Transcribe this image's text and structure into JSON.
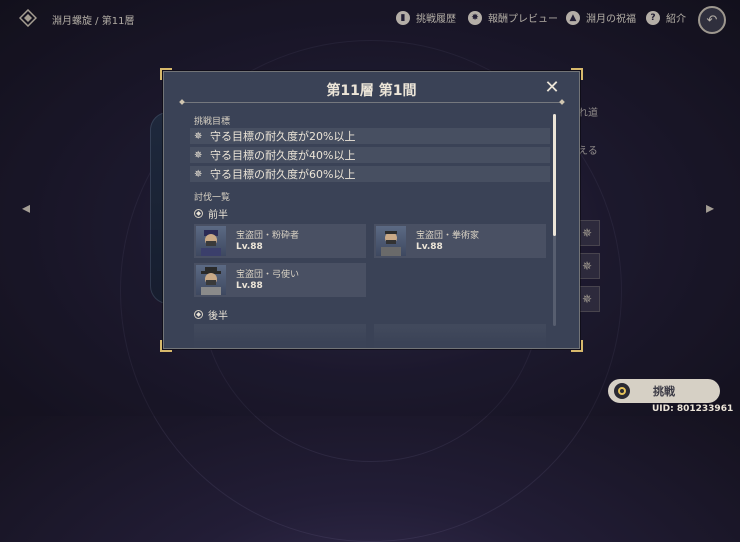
{
  "topbar": {
    "breadcrumb": "淵月螺旋 / 第11層",
    "nav": [
      {
        "label": "挑戦履歴",
        "icon": "book-icon"
      },
      {
        "label": "報酬プレビュー",
        "icon": "gear-icon"
      },
      {
        "label": "淵月の祝福",
        "icon": "blessing-icon"
      },
      {
        "label": "紹介",
        "icon": "help-icon"
      }
    ]
  },
  "background": {
    "right_text_1": "れ道",
    "right_text_2": "える"
  },
  "modal": {
    "title": "第11層 第1間",
    "goals_label": "挑戦目標",
    "goals": [
      "守る目標の耐久度が20%以上",
      "守る目標の耐久度が40%以上",
      "守る目標の耐久度が60%以上"
    ],
    "enemies_label": "討伐一覧",
    "first_half_label": "前半",
    "second_half_label": "後半",
    "first_half_enemies": [
      {
        "name": "宝盗団・粉砕者",
        "level": "Lv.88"
      },
      {
        "name": "宝盗団・拳術家",
        "level": "Lv.88"
      },
      {
        "name": "宝盗団・弓使い",
        "level": "Lv.88"
      }
    ]
  },
  "footer": {
    "start_label": "挑戦",
    "uid": "UID: 801233961"
  }
}
